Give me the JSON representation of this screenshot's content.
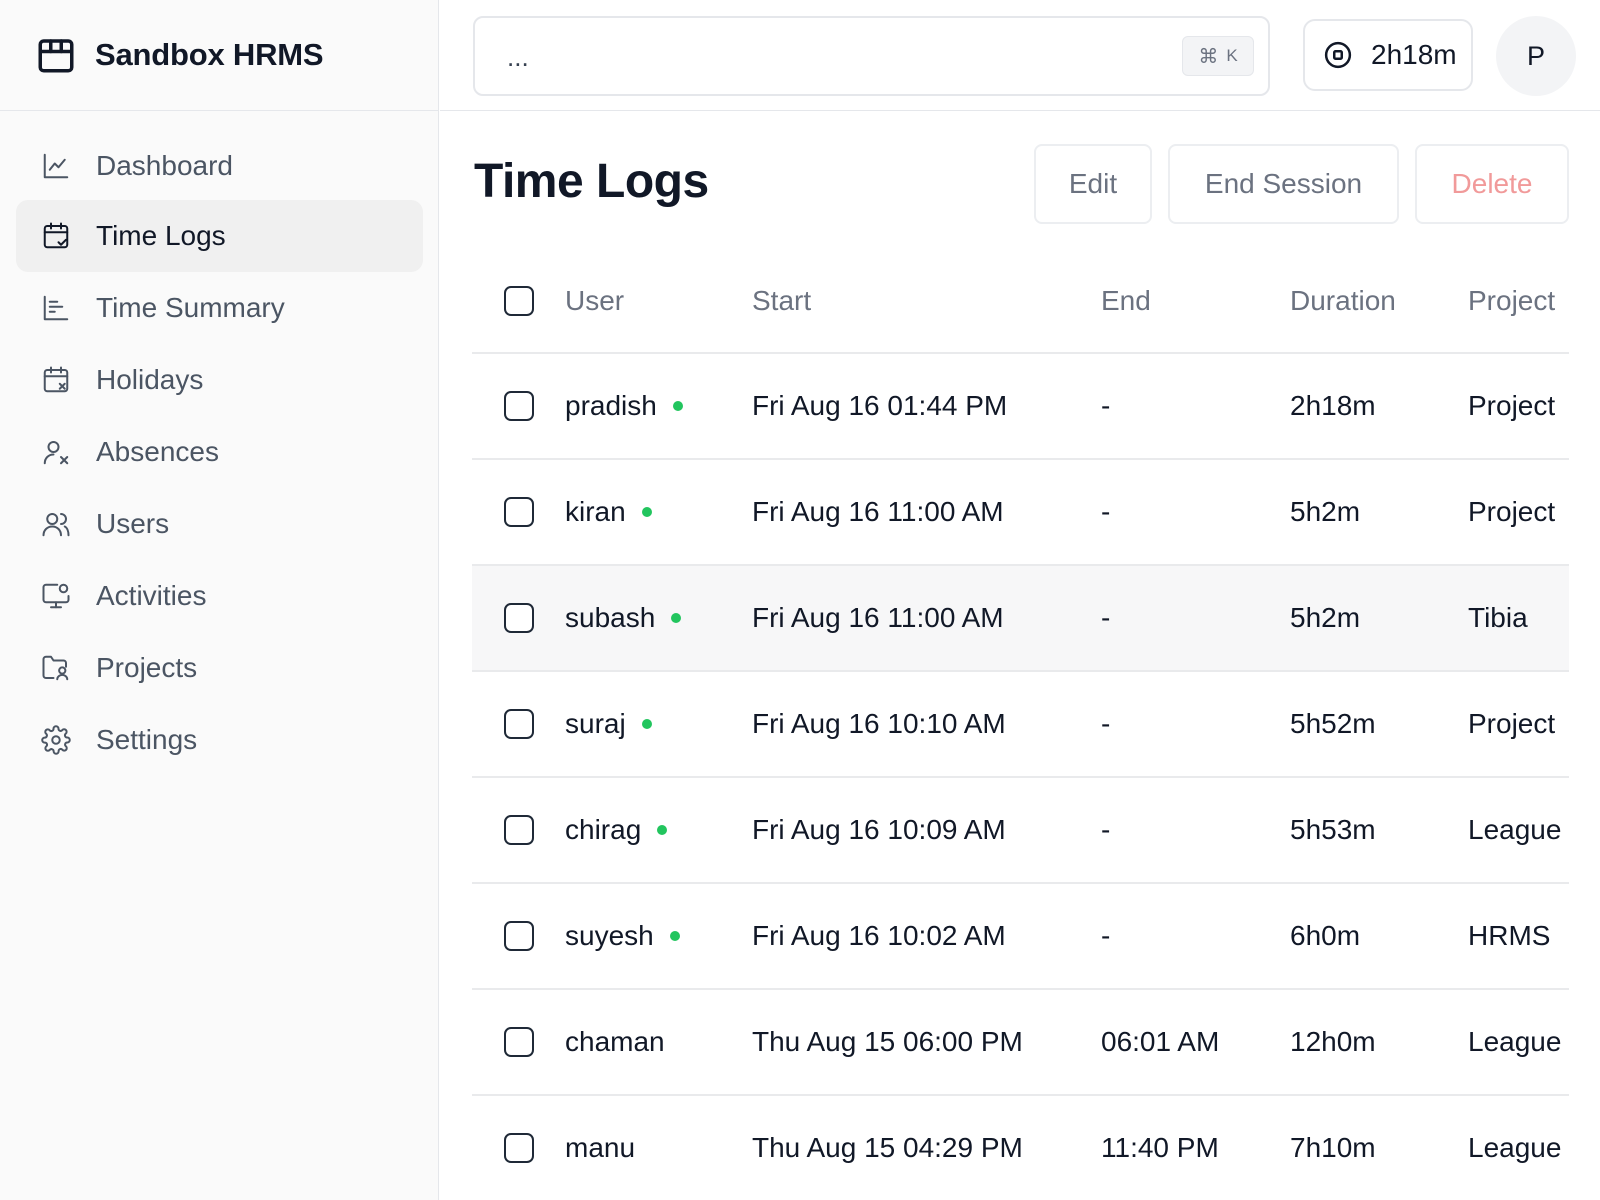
{
  "app": {
    "title": "Sandbox HRMS"
  },
  "sidebar": {
    "items": [
      {
        "label": "Dashboard",
        "icon": "line-chart-icon",
        "active": false
      },
      {
        "label": "Time Logs",
        "icon": "calendar-check-icon",
        "active": true
      },
      {
        "label": "Time Summary",
        "icon": "bar-chart-icon",
        "active": false
      },
      {
        "label": "Holidays",
        "icon": "calendar-x-icon",
        "active": false
      },
      {
        "label": "Absences",
        "icon": "user-x-icon",
        "active": false
      },
      {
        "label": "Users",
        "icon": "users-icon",
        "active": false
      },
      {
        "label": "Activities",
        "icon": "monitor-cog-icon",
        "active": false
      },
      {
        "label": "Projects",
        "icon": "folder-user-icon",
        "active": false
      },
      {
        "label": "Settings",
        "icon": "gear-icon",
        "active": false
      }
    ]
  },
  "header": {
    "search": {
      "value": "...",
      "shortcut_symbol": "⌘",
      "shortcut_key": "K"
    },
    "timer": {
      "value": "2h18m",
      "icon": "stop-circle-icon"
    },
    "avatar": {
      "initial": "P"
    }
  },
  "main": {
    "title": "Time Logs",
    "actions": {
      "edit": "Edit",
      "end_session": "End Session",
      "delete": "Delete"
    },
    "table": {
      "columns": {
        "user": "User",
        "start": "Start",
        "end": "End",
        "duration": "Duration",
        "project": "Project"
      },
      "rows": [
        {
          "user": "pradish",
          "active": true,
          "start": "Fri Aug 16 01:44 PM",
          "end": "-",
          "duration": "2h18m",
          "project": "Project"
        },
        {
          "user": "kiran",
          "active": true,
          "start": "Fri Aug 16 11:00 AM",
          "end": "-",
          "duration": "5h2m",
          "project": "Project"
        },
        {
          "user": "subash",
          "active": true,
          "start": "Fri Aug 16 11:00 AM",
          "end": "-",
          "duration": "5h2m",
          "project": "Tibia"
        },
        {
          "user": "suraj",
          "active": true,
          "start": "Fri Aug 16 10:10 AM",
          "end": "-",
          "duration": "5h52m",
          "project": "Project"
        },
        {
          "user": "chirag",
          "active": true,
          "start": "Fri Aug 16 10:09 AM",
          "end": "-",
          "duration": "5h53m",
          "project": "League"
        },
        {
          "user": "suyesh",
          "active": true,
          "start": "Fri Aug 16 10:02 AM",
          "end": "-",
          "duration": "6h0m",
          "project": "HRMS"
        },
        {
          "user": "chaman",
          "active": false,
          "start": "Thu Aug 15 06:00 PM",
          "end": "06:01 AM",
          "duration": "12h0m",
          "project": "League"
        },
        {
          "user": "manu",
          "active": false,
          "start": "Thu Aug 15 04:29 PM",
          "end": "11:40 PM",
          "duration": "7h10m",
          "project": "League"
        }
      ]
    }
  },
  "colors": {
    "accent_active": "#22c55e",
    "danger": "#f19a9a",
    "sidebar_bg": "#fafafa"
  }
}
